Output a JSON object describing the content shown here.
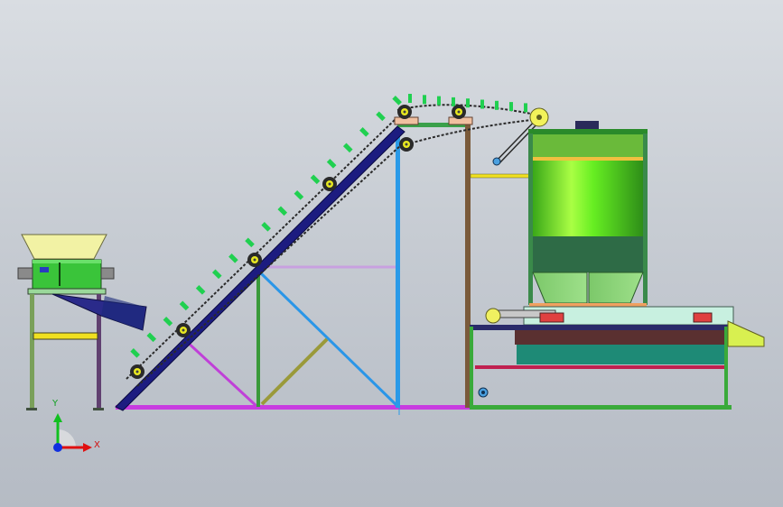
{
  "viewport": {
    "background": "#c7ccd3"
  },
  "axes_triad": {
    "x_label": "X",
    "y_label": "Y",
    "x_color": "#e01010",
    "y_color": "#10c020",
    "origin_color": "#1030e0"
  },
  "colors": {
    "frame_purple": "#c030d8",
    "frame_blue": "#2090e8",
    "frame_olive": "#8a8a2a",
    "frame_green": "#2a8a2a",
    "conveyor_navy": "#1a1a7a",
    "conveyor_chain": "#303030",
    "cleat_green": "#20d050",
    "sprocket_yellow": "#e8e820",
    "hopper_yellow": "#f0f0a0",
    "shredder_green": "#30c030",
    "tank_green": "#66ee22",
    "tank_dark": "#2e6b46",
    "base_teal": "#1e8a76",
    "base_maroon": "#5a3030",
    "outlet_yellow": "#d8f050",
    "column_brown": "#7a5a3a"
  },
  "components": [
    "shredder-hopper",
    "shredder-body",
    "shredder-stand",
    "discharge-chute",
    "inclined-conveyor",
    "conveyor-support-frame",
    "vertical-column",
    "storage-tank",
    "drive-pulley",
    "base-platform",
    "outlet-chute"
  ]
}
